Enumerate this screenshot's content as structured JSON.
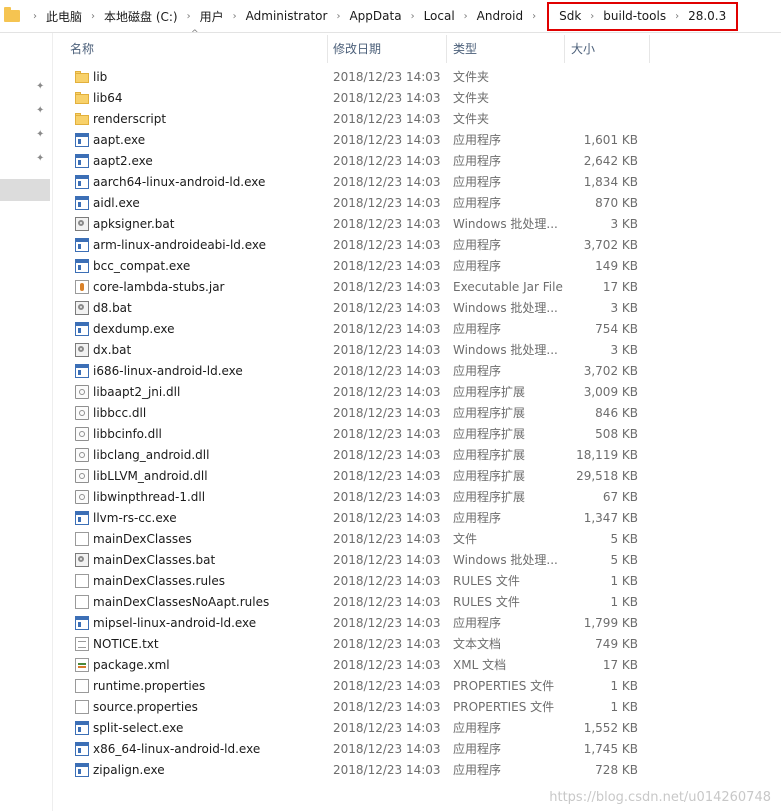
{
  "breadcrumb": {
    "items": [
      "此电脑",
      "本地磁盘 (C:)",
      "用户",
      "Administrator",
      "AppData",
      "Local",
      "Android"
    ],
    "highlighted": [
      "Sdk",
      "build-tools",
      "28.0.3"
    ]
  },
  "columns": {
    "name": "名称",
    "date": "修改日期",
    "type": "类型",
    "size": "大小"
  },
  "files": [
    {
      "icon": "folder-icon",
      "name": "lib",
      "date": "2018/12/23 14:03",
      "type": "文件夹",
      "size": ""
    },
    {
      "icon": "folder-icon",
      "name": "lib64",
      "date": "2018/12/23 14:03",
      "type": "文件夹",
      "size": ""
    },
    {
      "icon": "folder-icon",
      "name": "renderscript",
      "date": "2018/12/23 14:03",
      "type": "文件夹",
      "size": ""
    },
    {
      "icon": "exe-icon",
      "name": "aapt.exe",
      "date": "2018/12/23 14:03",
      "type": "应用程序",
      "size": "1,601 KB"
    },
    {
      "icon": "exe-icon",
      "name": "aapt2.exe",
      "date": "2018/12/23 14:03",
      "type": "应用程序",
      "size": "2,642 KB"
    },
    {
      "icon": "exe-icon",
      "name": "aarch64-linux-android-ld.exe",
      "date": "2018/12/23 14:03",
      "type": "应用程序",
      "size": "1,834 KB"
    },
    {
      "icon": "exe-icon",
      "name": "aidl.exe",
      "date": "2018/12/23 14:03",
      "type": "应用程序",
      "size": "870 KB"
    },
    {
      "icon": "bat-icon",
      "name": "apksigner.bat",
      "date": "2018/12/23 14:03",
      "type": "Windows 批处理...",
      "size": "3 KB"
    },
    {
      "icon": "exe-icon",
      "name": "arm-linux-androideabi-ld.exe",
      "date": "2018/12/23 14:03",
      "type": "应用程序",
      "size": "3,702 KB"
    },
    {
      "icon": "exe-icon",
      "name": "bcc_compat.exe",
      "date": "2018/12/23 14:03",
      "type": "应用程序",
      "size": "149 KB"
    },
    {
      "icon": "jar-icon",
      "name": "core-lambda-stubs.jar",
      "date": "2018/12/23 14:03",
      "type": "Executable Jar File",
      "size": "17 KB"
    },
    {
      "icon": "bat-icon",
      "name": "d8.bat",
      "date": "2018/12/23 14:03",
      "type": "Windows 批处理...",
      "size": "3 KB"
    },
    {
      "icon": "exe-icon",
      "name": "dexdump.exe",
      "date": "2018/12/23 14:03",
      "type": "应用程序",
      "size": "754 KB"
    },
    {
      "icon": "bat-icon",
      "name": "dx.bat",
      "date": "2018/12/23 14:03",
      "type": "Windows 批处理...",
      "size": "3 KB"
    },
    {
      "icon": "exe-icon",
      "name": "i686-linux-android-ld.exe",
      "date": "2018/12/23 14:03",
      "type": "应用程序",
      "size": "3,702 KB"
    },
    {
      "icon": "dll-icon",
      "name": "libaapt2_jni.dll",
      "date": "2018/12/23 14:03",
      "type": "应用程序扩展",
      "size": "3,009 KB"
    },
    {
      "icon": "dll-icon",
      "name": "libbcc.dll",
      "date": "2018/12/23 14:03",
      "type": "应用程序扩展",
      "size": "846 KB"
    },
    {
      "icon": "dll-icon",
      "name": "libbcinfo.dll",
      "date": "2018/12/23 14:03",
      "type": "应用程序扩展",
      "size": "508 KB"
    },
    {
      "icon": "dll-icon",
      "name": "libclang_android.dll",
      "date": "2018/12/23 14:03",
      "type": "应用程序扩展",
      "size": "18,119 KB"
    },
    {
      "icon": "dll-icon",
      "name": "libLLVM_android.dll",
      "date": "2018/12/23 14:03",
      "type": "应用程序扩展",
      "size": "29,518 KB"
    },
    {
      "icon": "dll-icon",
      "name": "libwinpthread-1.dll",
      "date": "2018/12/23 14:03",
      "type": "应用程序扩展",
      "size": "67 KB"
    },
    {
      "icon": "exe-icon",
      "name": "llvm-rs-cc.exe",
      "date": "2018/12/23 14:03",
      "type": "应用程序",
      "size": "1,347 KB"
    },
    {
      "icon": "file-icon",
      "name": "mainDexClasses",
      "date": "2018/12/23 14:03",
      "type": "文件",
      "size": "5 KB"
    },
    {
      "icon": "bat-icon",
      "name": "mainDexClasses.bat",
      "date": "2018/12/23 14:03",
      "type": "Windows 批处理...",
      "size": "5 KB"
    },
    {
      "icon": "file-icon",
      "name": "mainDexClasses.rules",
      "date": "2018/12/23 14:03",
      "type": "RULES 文件",
      "size": "1 KB"
    },
    {
      "icon": "file-icon",
      "name": "mainDexClassesNoAapt.rules",
      "date": "2018/12/23 14:03",
      "type": "RULES 文件",
      "size": "1 KB"
    },
    {
      "icon": "exe-icon",
      "name": "mipsel-linux-android-ld.exe",
      "date": "2018/12/23 14:03",
      "type": "应用程序",
      "size": "1,799 KB"
    },
    {
      "icon": "txt-icon",
      "name": "NOTICE.txt",
      "date": "2018/12/23 14:03",
      "type": "文本文档",
      "size": "749 KB"
    },
    {
      "icon": "xml-icon",
      "name": "package.xml",
      "date": "2018/12/23 14:03",
      "type": "XML 文档",
      "size": "17 KB"
    },
    {
      "icon": "file-icon",
      "name": "runtime.properties",
      "date": "2018/12/23 14:03",
      "type": "PROPERTIES 文件",
      "size": "1 KB"
    },
    {
      "icon": "file-icon",
      "name": "source.properties",
      "date": "2018/12/23 14:03",
      "type": "PROPERTIES 文件",
      "size": "1 KB"
    },
    {
      "icon": "exe-icon",
      "name": "split-select.exe",
      "date": "2018/12/23 14:03",
      "type": "应用程序",
      "size": "1,552 KB"
    },
    {
      "icon": "exe-icon",
      "name": "x86_64-linux-android-ld.exe",
      "date": "2018/12/23 14:03",
      "type": "应用程序",
      "size": "1,745 KB"
    },
    {
      "icon": "exe-icon",
      "name": "zipalign.exe",
      "date": "2018/12/23 14:03",
      "type": "应用程序",
      "size": "728 KB"
    }
  ],
  "watermark": "https://blog.csdn.net/u014260748",
  "colors": {
    "highlight_border": "#e00000",
    "folder": "#f8d16a",
    "exe": "#3c6fb6",
    "header_text": "#4c607a"
  }
}
